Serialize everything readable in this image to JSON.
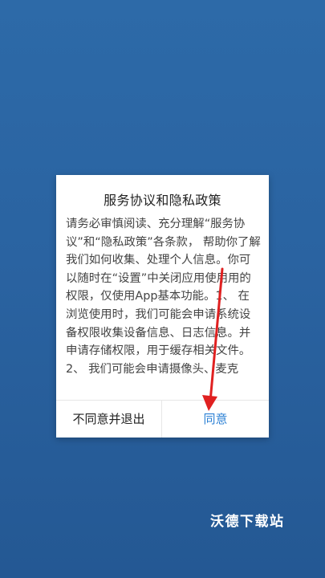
{
  "dialog": {
    "title": "服务协议和隐私政策",
    "body": "请务必审慎阅读、充分理解“服务协议”和“隐私政策”各条款， 帮助你了解我们如何收集、处理个人信息。你可以随时在“设置”中关闭应用使用用的权限，仅使用App基本功能。1、 在浏览使用时，我们可能会申请系统设备权限收集设备信息、日志信息。并申请存储权限，用于缓存相关文件。2、 我们可能会申请摄像头、麦克",
    "disagree_label": "不同意并退出",
    "agree_label": "同意"
  },
  "watermark": "沃德下载站",
  "colors": {
    "background": "#2a63a1",
    "agree_text": "#2a7fd4",
    "arrow": "#e02020"
  }
}
